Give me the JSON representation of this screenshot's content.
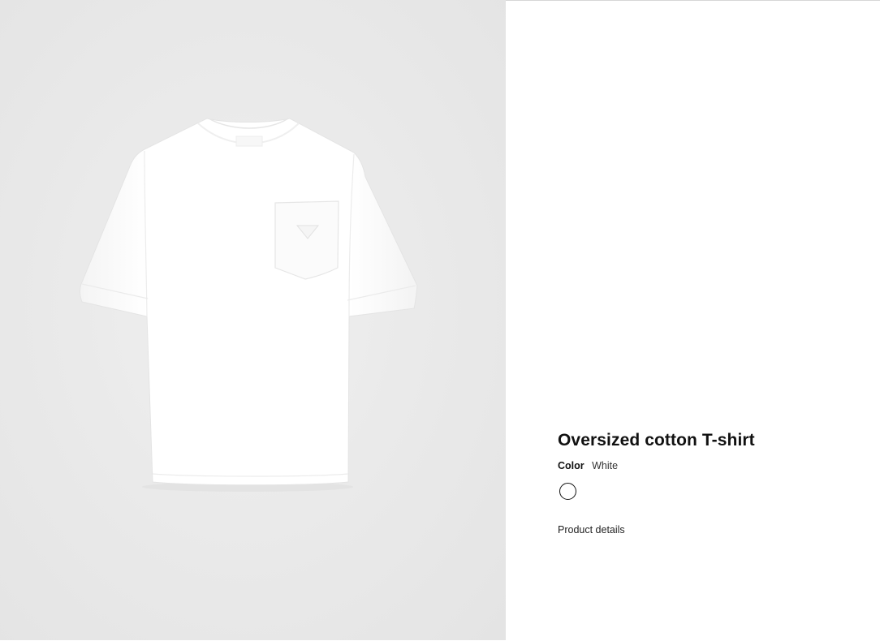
{
  "product": {
    "title": "Oversized cotton T-shirt",
    "color_label": "Color",
    "color_value": "White",
    "swatch_color": "#ffffff",
    "details_link": "Product details"
  },
  "colors": {
    "gallery_background": "#e8e8e8",
    "text_primary": "#111111"
  }
}
